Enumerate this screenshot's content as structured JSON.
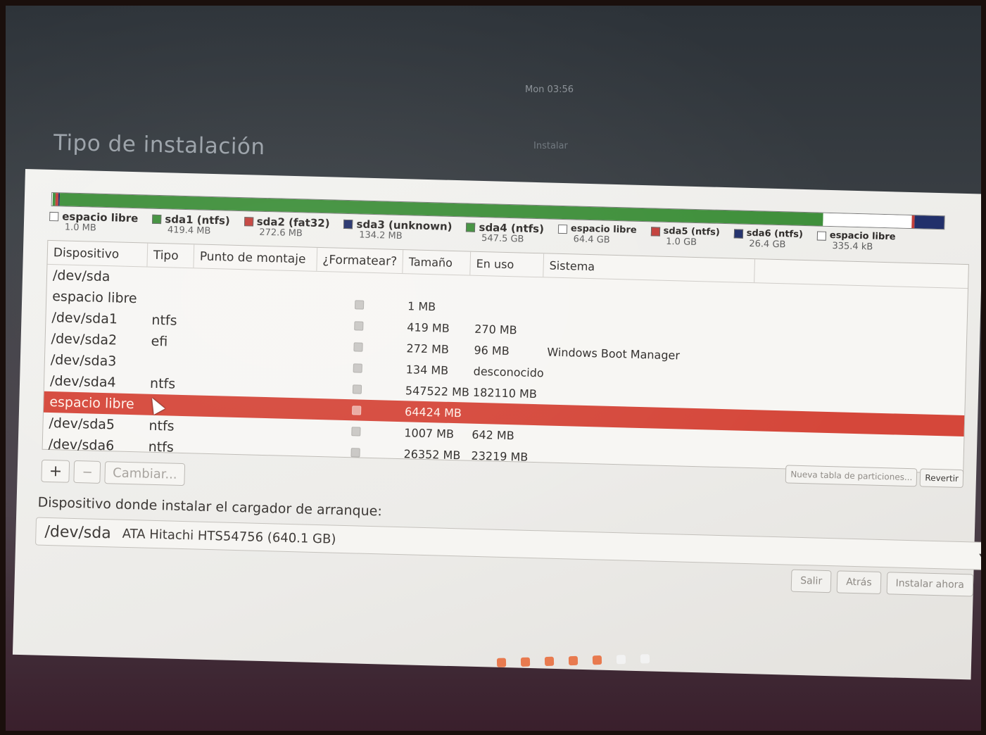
{
  "system": {
    "clock": "Mon 03:56",
    "window_title": "Instalar"
  },
  "page": {
    "title": "Tipo de instalación"
  },
  "partition_bar": [
    {
      "label": "espacio libre",
      "size": "1.0 MB",
      "color": "#ffffff"
    },
    {
      "label": "sda1 (ntfs)",
      "size": "419.4 MB",
      "color": "#3e8f3a"
    },
    {
      "label": "sda2 (fat32)",
      "size": "272.6 MB",
      "color": "#c33f3a"
    },
    {
      "label": "sda3 (unknown)",
      "size": "134.2 MB",
      "color": "#22306b"
    },
    {
      "label": "sda4 (ntfs)",
      "size": "547.5 GB",
      "color": "#3e8f3a"
    },
    {
      "label": "espacio libre",
      "size": "64.4 GB",
      "color": "#ffffff"
    },
    {
      "label": "sda5 (ntfs)",
      "size": "1.0 GB",
      "color": "#c33f3a"
    },
    {
      "label": "sda6 (ntfs)",
      "size": "26.4 GB",
      "color": "#22306b"
    },
    {
      "label": "espacio libre",
      "size": "335.4 kB",
      "color": "#ffffff"
    }
  ],
  "bar_fractions": [
    0.001,
    0.003,
    0.003,
    0.002,
    0.855,
    0.1,
    0.003,
    0.033,
    0.0
  ],
  "table": {
    "headers": [
      "Dispositivo",
      "Tipo",
      "Punto de montaje",
      "¿Formatear?",
      "Tamaño",
      "En uso",
      "Sistema"
    ],
    "rows": [
      {
        "device": "/dev/sda",
        "type": "",
        "mount": "",
        "size": "",
        "used": "",
        "system": "",
        "checkbox": false
      },
      {
        "device": "espacio libre",
        "type": "",
        "mount": "",
        "size": "1 MB",
        "used": "",
        "system": "",
        "checkbox": true
      },
      {
        "device": "/dev/sda1",
        "type": "ntfs",
        "mount": "",
        "size": "419 MB",
        "used": "270 MB",
        "system": "",
        "checkbox": true
      },
      {
        "device": "/dev/sda2",
        "type": "efi",
        "mount": "",
        "size": "272 MB",
        "used": "96 MB",
        "system": "Windows Boot Manager",
        "checkbox": true
      },
      {
        "device": "/dev/sda3",
        "type": "",
        "mount": "",
        "size": "134 MB",
        "used": "desconocido",
        "system": "",
        "checkbox": true
      },
      {
        "device": "/dev/sda4",
        "type": "ntfs",
        "mount": "",
        "size": "547522 MB",
        "used": "182110 MB",
        "system": "",
        "checkbox": true
      },
      {
        "device": "espacio libre",
        "type": "",
        "mount": "",
        "size": "64424 MB",
        "used": "",
        "system": "",
        "checkbox": true,
        "selected": true
      },
      {
        "device": "/dev/sda5",
        "type": "ntfs",
        "mount": "",
        "size": "1007 MB",
        "used": "642 MB",
        "system": "",
        "checkbox": true
      },
      {
        "device": "/dev/sda6",
        "type": "ntfs",
        "mount": "",
        "size": "26352 MB",
        "used": "23219 MB",
        "system": "",
        "checkbox": true
      }
    ]
  },
  "toolbar": {
    "add": "+",
    "remove": "−",
    "change": "Cambiar..."
  },
  "table_actions": {
    "new_table": "Nueva tabla de particiones...",
    "revert": "Revertir"
  },
  "bootloader": {
    "label": "Dispositivo donde instalar el cargador de arranque:",
    "device": "/dev/sda",
    "description": "ATA Hitachi HTS54756 (640.1 GB)"
  },
  "navigation": {
    "quit": "Salir",
    "back": "Atrás",
    "install": "Instalar ahora"
  },
  "progress": {
    "steps_done": 5,
    "steps_total": 7,
    "done_color": "#e87a4f",
    "pending_color": "#f2f2f2"
  }
}
